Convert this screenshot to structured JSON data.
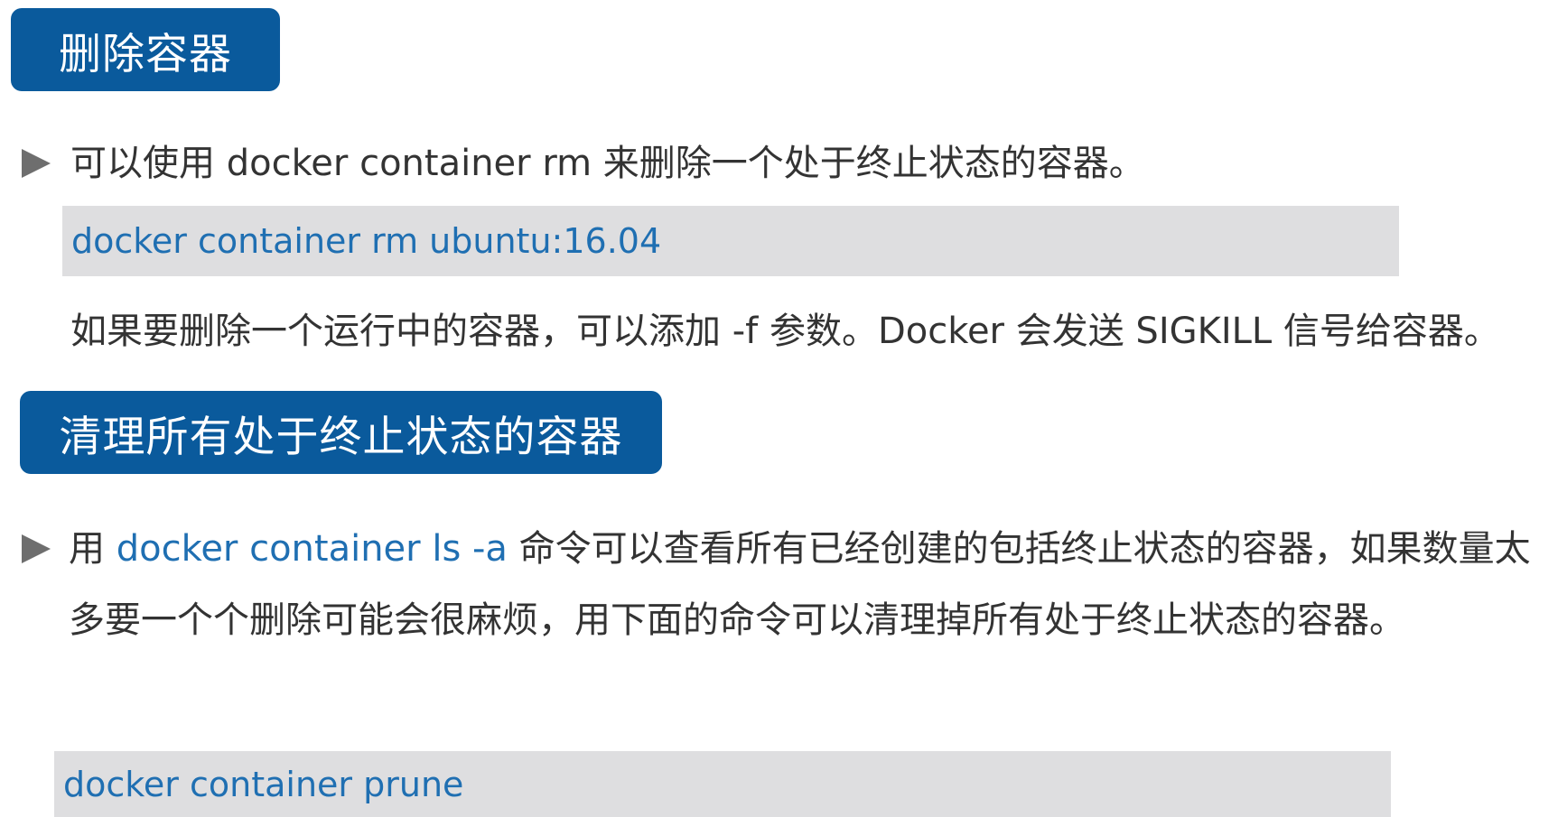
{
  "sections": [
    {
      "heading": "删除容器",
      "bullet_text": "可以使用 docker container rm 来删除一个处于终止状态的容器。",
      "code": "docker container rm ubuntu:16.04",
      "note": "如果要删除一个运行中的容器，可以添加 -f 参数。Docker 会发送 SIGKILL 信号给容器。"
    },
    {
      "heading": "清理所有处于终止状态的容器",
      "bullet_prefix": "用 ",
      "bullet_command": "docker container ls -a",
      "bullet_suffix": " 命令可以查看所有已经创建的包括终止状态的容器，如果数量太多要一个个删除可能会很麻烦，用下面的命令可以清理掉所有处于终止状态的容器。",
      "code": "docker container prune"
    }
  ],
  "colors": {
    "heading_bg": "#0a5a9c",
    "heading_text": "#ffffff",
    "code_bg": "#dedee0",
    "code_text": "#1f6fb2",
    "body_text": "#333333",
    "bullet": "#6e6e6e"
  },
  "icons": {
    "bullet": "triangle-right-icon"
  }
}
